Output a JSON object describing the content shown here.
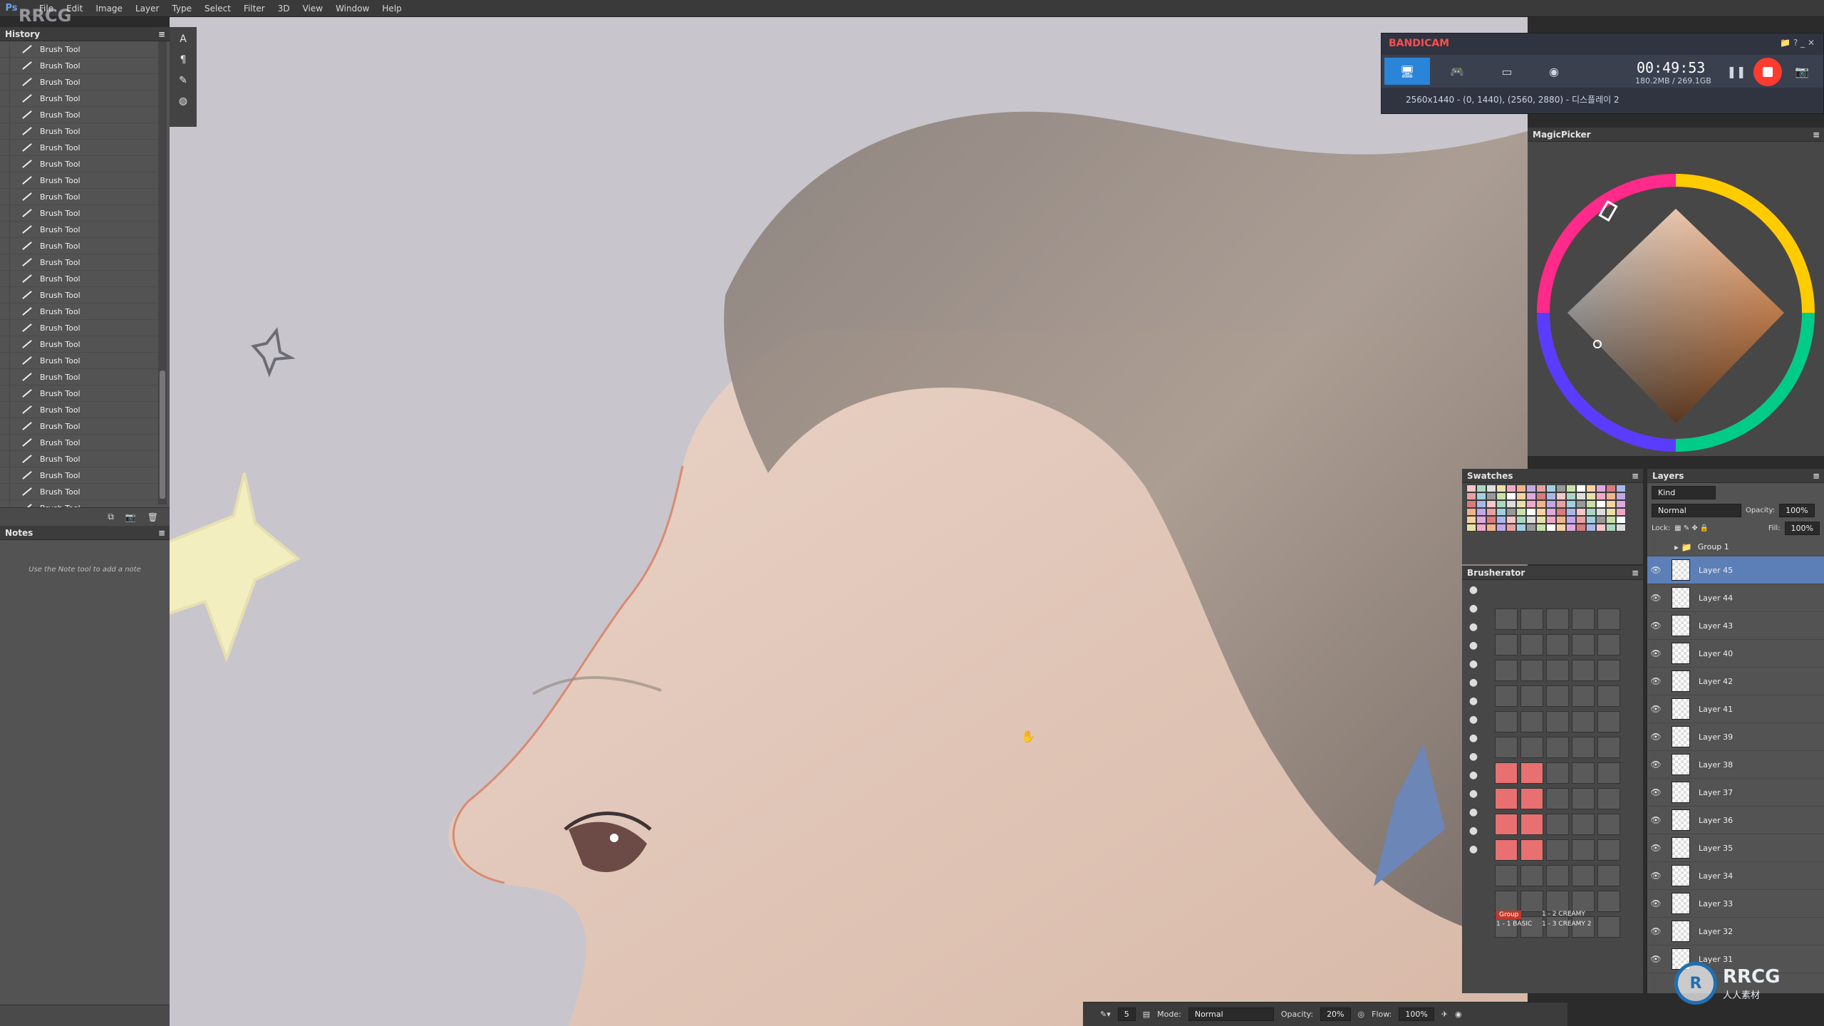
{
  "menubar": {
    "logo": "Ps",
    "items": [
      "File",
      "Edit",
      "Image",
      "Layer",
      "Type",
      "Select",
      "Filter",
      "3D",
      "View",
      "Window",
      "Help"
    ]
  },
  "history": {
    "title": "History",
    "items": [
      "Brush Tool",
      "Brush Tool",
      "Brush Tool",
      "Brush Tool",
      "Brush Tool",
      "Brush Tool",
      "Brush Tool",
      "Brush Tool",
      "Brush Tool",
      "Brush Tool",
      "Brush Tool",
      "Brush Tool",
      "Brush Tool",
      "Brush Tool",
      "Brush Tool",
      "Brush Tool",
      "Brush Tool",
      "Brush Tool",
      "Brush Tool",
      "Brush Tool",
      "Brush Tool",
      "Brush Tool",
      "Brush Tool",
      "Brush Tool",
      "Brush Tool",
      "Brush Tool",
      "Brush Tool",
      "Brush Tool",
      "Brush Tool",
      "Brush Tool"
    ],
    "selected_index": 29
  },
  "notes": {
    "title": "Notes",
    "hint": "Use the Note tool to add a note"
  },
  "bandicam": {
    "brand_a": "BANDI",
    "brand_b": "CAM",
    "time": "00:49:53",
    "size": "180.2MB / 269.1GB",
    "resolution": "2560x1440 - (0, 1440), (2560, 2880) - 디스플레이 2"
  },
  "magicpicker": {
    "title": "MagicPicker"
  },
  "swatches": {
    "title": "Swatches"
  },
  "brusherator": {
    "title": "Brusherator",
    "group_label": "Group",
    "preset_1": "1 - 2 CREAMY",
    "preset_2": "1 - 1 BASIC",
    "preset_3": "1 - 3 CREAMY 2"
  },
  "layers": {
    "title": "Layers",
    "filter": "Kind",
    "blend_mode": "Normal",
    "opacity_label": "Opacity:",
    "opacity": "100%",
    "lock_label": "Lock:",
    "fill_label": "Fill:",
    "fill": "100%",
    "group": "Group 1",
    "items": [
      "Layer 45",
      "Layer 44",
      "Layer 43",
      "Layer 40",
      "Layer 42",
      "Layer 41",
      "Layer 39",
      "Layer 38",
      "Layer 37",
      "Layer 36",
      "Layer 35",
      "Layer 34",
      "Layer 33",
      "Layer 32",
      "Layer 31"
    ],
    "selected_index": 0
  },
  "options": {
    "size": "5",
    "mode_label": "Mode:",
    "mode": "Normal",
    "opacity_label": "Opacity:",
    "opacity": "20%",
    "flow_label": "Flow:",
    "flow": "100%"
  },
  "watermark": {
    "text": "RRCG",
    "sub": "人人素材",
    "top_left": "RRCG"
  },
  "colors": {
    "canvas": "#c8c5cd",
    "selection": "#7f9bc8",
    "record": "#ff3b30"
  }
}
